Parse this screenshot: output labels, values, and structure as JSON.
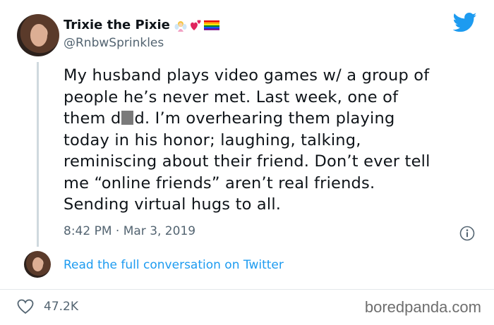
{
  "author": {
    "name": "Trixie the Pixie",
    "handle": "@RnbwSprinkles",
    "name_icons": [
      "fairy-emoji-icon",
      "hearts-emoji-icon",
      "rainbow-flag-icon"
    ]
  },
  "tweet": {
    "lines": [
      "My husband plays video games w/ a group of",
      "people he’s never met. Last week, one of",
      [
        "them d",
        "d. I’m overhearing them playing"
      ],
      "today in his honor; laughing, talking,",
      "reminiscing about their friend. Don’t ever tell",
      "me “online friends” aren’t real friends.",
      "Sending virtual hugs to all."
    ],
    "timestamp": "8:42 PM · Mar 3, 2019"
  },
  "footer": {
    "read_link": "Read the full conversation on Twitter",
    "likes": "47.2K",
    "watermark": "boredpanda.com"
  },
  "colors": {
    "accent": "#1d9bf0",
    "secondary_text": "#536471",
    "twitter_blue": "#1d9bf0"
  }
}
